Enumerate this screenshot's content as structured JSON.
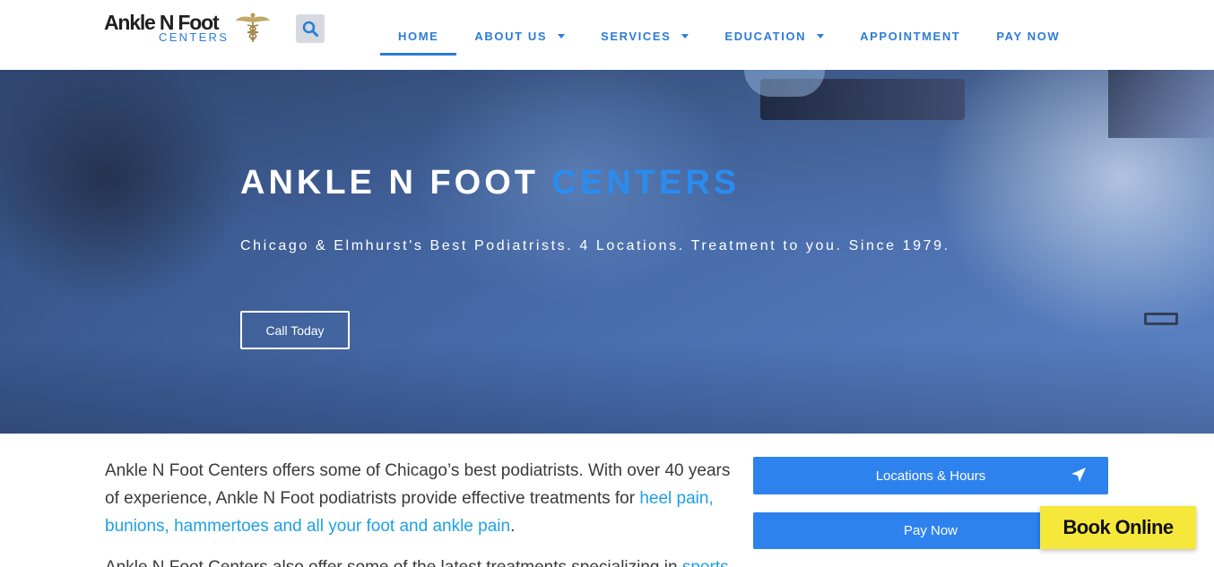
{
  "header": {
    "logo": {
      "main": "Ankle N Foot",
      "sub": "CENTERS"
    },
    "search_icon": "search-icon",
    "nav": [
      {
        "label": "HOME",
        "active": true,
        "dropdown": false
      },
      {
        "label": "ABOUT US",
        "active": false,
        "dropdown": true
      },
      {
        "label": "SERVICES",
        "active": false,
        "dropdown": true
      },
      {
        "label": "EDUCATION",
        "active": false,
        "dropdown": true
      },
      {
        "label": "APPOINTMENT",
        "active": false,
        "dropdown": false
      },
      {
        "label": "PAY NOW",
        "active": false,
        "dropdown": false
      }
    ]
  },
  "hero": {
    "title_main": "ANKLE N FOOT ",
    "title_accent": "CENTERS",
    "subtitle": "Chicago & Elmhurst's Best Podiatrists. 4 Locations. Treatment to you. Since 1979.",
    "cta": "Call Today"
  },
  "content": {
    "intro_text": "Ankle N Foot Centers offers some of Chicago’s best podiatrists. With over 40 years of experience, Ankle N Foot podiatrists provide effective treatments for ",
    "intro_link": "heel pain, bunions, hammertoes and all your foot and ankle pain",
    "intro_end": ".",
    "intro2_text": "Ankle N Foot Centers also offer some of the latest treatments specializing in ",
    "intro2_link": "sports"
  },
  "sidebar": {
    "locations_button": "Locations & Hours",
    "locations_icon": "location-arrow-icon",
    "pay_button": "Pay Now"
  },
  "floating": {
    "book_online": "Book Online"
  },
  "colors": {
    "brand_blue": "#2b7cd8",
    "button_blue": "#2d82ee",
    "link_blue": "#1ea0e6",
    "book_yellow": "#f5e83b"
  }
}
